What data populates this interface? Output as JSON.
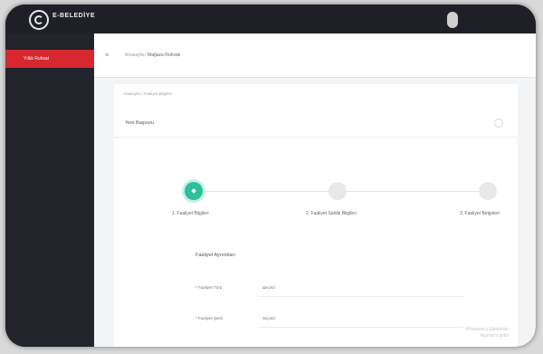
{
  "brand": {
    "name": "E-BELEDİYE",
    "tagline": ""
  },
  "user": {
    "lines": [
      "",
      "",
      ""
    ]
  },
  "sidebar": {
    "active_label": "Yıllık Ruhsat"
  },
  "breadcrumb": {
    "parts": [
      "Anasayfa",
      "Mağaza Ruhsatı"
    ]
  },
  "card": {
    "subcrumb": "Anasayfa / Faaliyet Bilgileri",
    "title": "Yeni Başvuru"
  },
  "stepper": {
    "steps": [
      {
        "label": "1. Faaliyet Bilgileri",
        "glyph": "⬥",
        "active": true
      },
      {
        "label": "2. Faaliyet Sahibi Bilgileri",
        "glyph": "",
        "active": false
      },
      {
        "label": "3. Faaliyet Belgeleri",
        "glyph": "",
        "active": false
      }
    ]
  },
  "form": {
    "title": "Faaliyet Ayrıntıları",
    "rows": [
      {
        "label": "* Faaliyet Türü",
        "value": "Seçiniz"
      },
      {
        "label": "* Faaliyet Şekli",
        "value": "Seçiniz"
      }
    ]
  },
  "watermark": [
    "Windows'u Etkinleştir",
    "Ayarlar'a gidin"
  ]
}
